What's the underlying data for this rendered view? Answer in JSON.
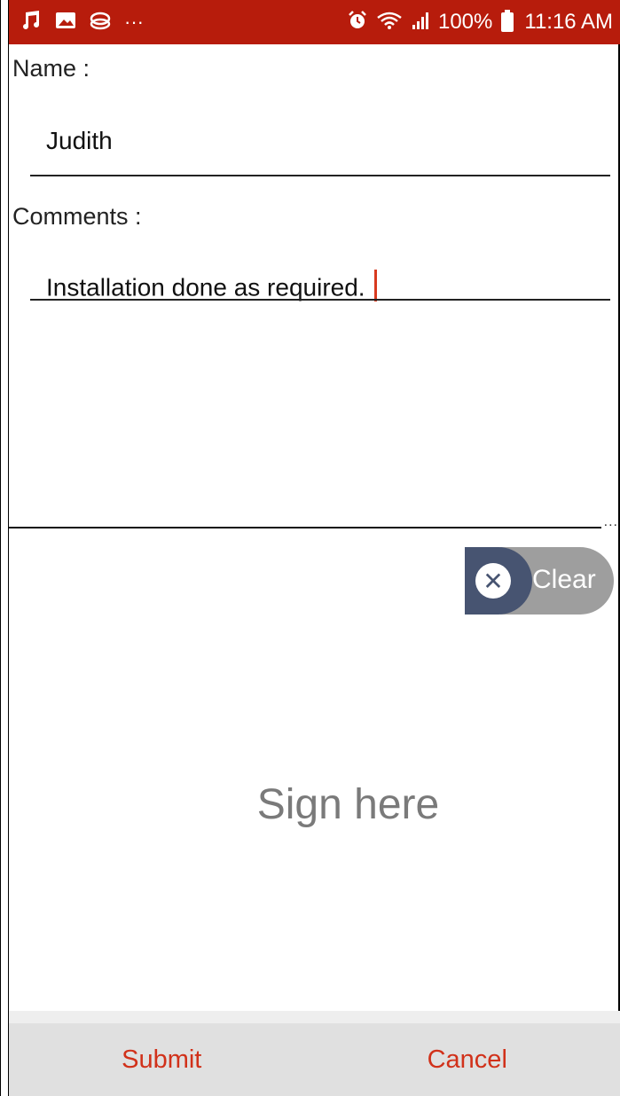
{
  "status_bar": {
    "left_icons": [
      "music-icon",
      "image-icon",
      "chat-icon",
      "more-icon"
    ],
    "more_glyph": "···",
    "battery_percent": "100%",
    "time": "11:16 AM"
  },
  "form": {
    "name_label": "Name :",
    "name_value": "Judith",
    "comments_label": "Comments :",
    "comments_value": "Installation done as required."
  },
  "signature": {
    "clear_label": "Clear",
    "placeholder": "Sign here",
    "overflow_glyph": "..."
  },
  "actions": {
    "submit_label": "Submit",
    "cancel_label": "Cancel"
  },
  "colors": {
    "status_bar": "#b71c0c",
    "accent": "#d1311a",
    "clear_dark": "#475471",
    "clear_gray": "#9e9e9e"
  }
}
